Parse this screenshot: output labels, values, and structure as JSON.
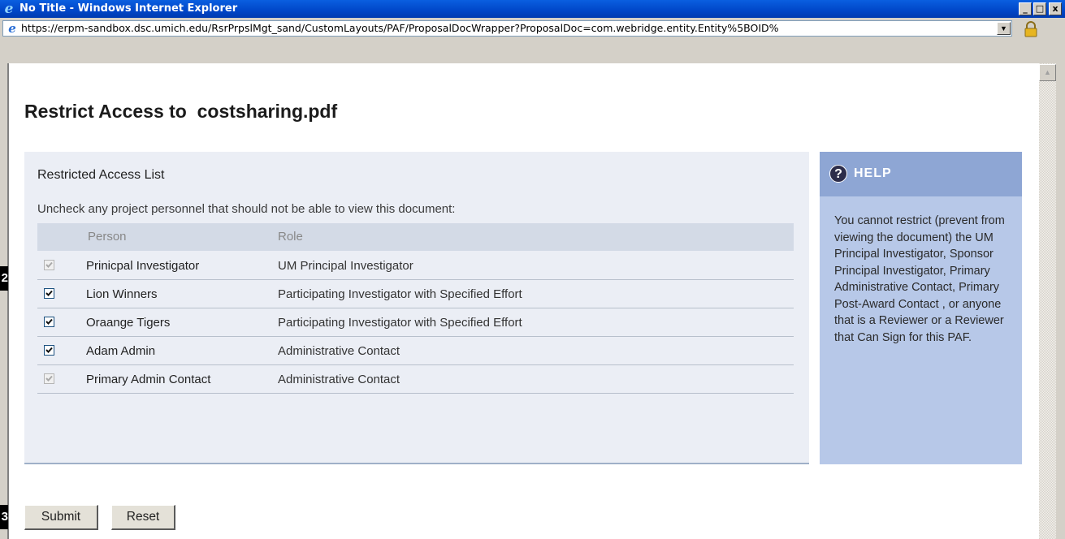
{
  "window": {
    "title": "No Title - Windows Internet Explorer",
    "minimize": "_",
    "maximize": "□",
    "close": "x"
  },
  "address": {
    "url": "https://erpm-sandbox.dsc.umich.edu/RsrPrpslMgt_sand/CustomLayouts/PAF/ProposalDocWrapper?ProposalDoc=com.webridge.entity.Entity%5BOID%",
    "dropdown": "▼"
  },
  "page": {
    "title": "Restrict Access to  costsharing.pdf"
  },
  "access_list": {
    "heading": "Restricted Access List",
    "instructions": "Uncheck any project personnel that should not be able to view this document:",
    "columns": {
      "person": "Person",
      "role": "Role"
    },
    "rows": [
      {
        "person": "Prinicpal Investigator",
        "role": "UM Principal Investigator",
        "checked": true,
        "disabled": true
      },
      {
        "person": "Lion Winners",
        "role": "Participating Investigator with Specified Effort",
        "checked": true,
        "disabled": false
      },
      {
        "person": "Oraange Tigers",
        "role": "Participating Investigator with Specified Effort",
        "checked": true,
        "disabled": false
      },
      {
        "person": "Adam Admin",
        "role": "Administrative Contact",
        "checked": true,
        "disabled": false
      },
      {
        "person": "Primary Admin Contact",
        "role": "Administrative Contact",
        "checked": true,
        "disabled": true
      }
    ]
  },
  "help": {
    "title": "HELP",
    "icon": "?",
    "text": "You cannot restrict (prevent from viewing the document) the UM Principal Investigator, Sponsor Principal Investigator, Primary Administrative Contact, Primary Post-Award Contact , or anyone that is a Reviewer or a Reviewer that Can Sign for this PAF."
  },
  "actions": {
    "submit": "Submit",
    "reset": "Reset"
  },
  "markers": {
    "m2": "2",
    "m3": "3"
  },
  "colors": {
    "title_bar": "#0046c8",
    "panel_bg": "#ebeef5",
    "help_header": "#8ea6d4",
    "help_bg": "#b7c8e8"
  }
}
